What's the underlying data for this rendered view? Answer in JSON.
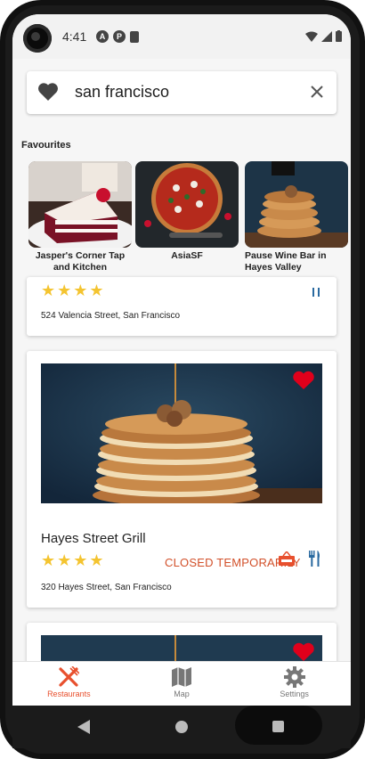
{
  "status": {
    "time": "4:41"
  },
  "search": {
    "query": "san francisco"
  },
  "favourites": {
    "title": "Favourites",
    "items": [
      {
        "label": "Jasper's Corner Tap and Kitchen"
      },
      {
        "label": "AsiaSF"
      },
      {
        "label": "Pause Wine Bar in Hayes Valley"
      }
    ]
  },
  "restaurants": [
    {
      "address": "524 Valencia Street, San Francisco",
      "rating": 4
    },
    {
      "name": "Hayes Street Grill",
      "status": "CLOSED TEMPORARILY",
      "address": "320 Hayes Street, San Francisco",
      "rating": 4,
      "favourite": true
    },
    {
      "favourite": true
    }
  ],
  "bottom_nav": {
    "restaurants": "Restaurants",
    "map": "Map",
    "settings": "Settings"
  },
  "colors": {
    "accent": "#e8502e",
    "heart_red": "#e0001b",
    "star": "#f4c430",
    "closed_text": "#d2502a",
    "utensil_blue": "#2a6aa0"
  }
}
